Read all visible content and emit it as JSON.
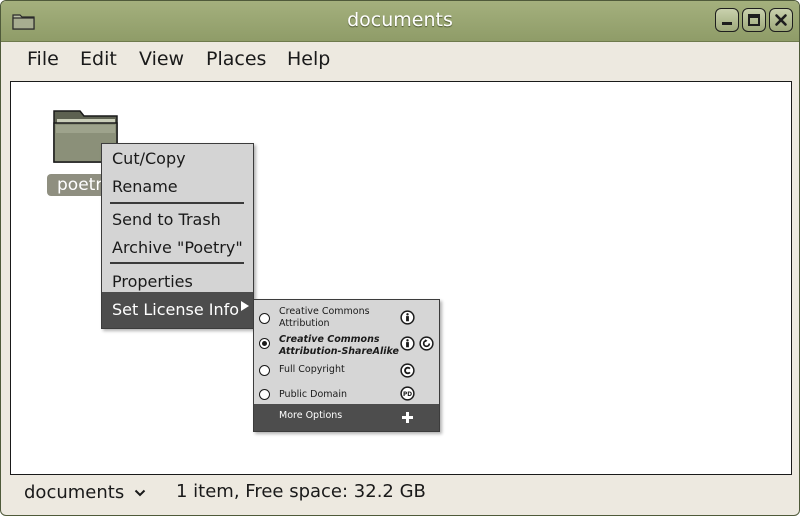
{
  "window": {
    "title": "documents"
  },
  "menubar": {
    "items": [
      "File",
      "Edit",
      "View",
      "Places",
      "Help"
    ]
  },
  "folder": {
    "label": "poetry"
  },
  "context_menu": {
    "items": [
      "Cut/Copy",
      "Rename",
      "Send to Trash",
      "Archive \"Poetry\"",
      "Properties",
      "Set License Info"
    ]
  },
  "license_menu": {
    "options": [
      {
        "label_line1": "Creative Commons",
        "label_line2": "Attribution",
        "selected": false,
        "icon": "cc-by-icon"
      },
      {
        "label_line1": "Creative Commons",
        "label_line2": "Attribution-ShareAlike",
        "selected": true,
        "icon": "cc-by-sa-icon"
      },
      {
        "label_line1": "Full Copyright",
        "label_line2": "",
        "selected": false,
        "icon": "copyright-icon"
      },
      {
        "label_line1": "Public Domain",
        "label_line2": "",
        "selected": false,
        "icon": "public-domain-icon"
      }
    ],
    "more_label": "More Options",
    "pd_text": "PD"
  },
  "statusbar": {
    "location": "documents",
    "info": "1 item, Free space: 32.2 GB"
  },
  "colors": {
    "titlebar": "#9aa673",
    "menu_highlight": "#4d4d4d",
    "selection": "#8f8f80"
  }
}
